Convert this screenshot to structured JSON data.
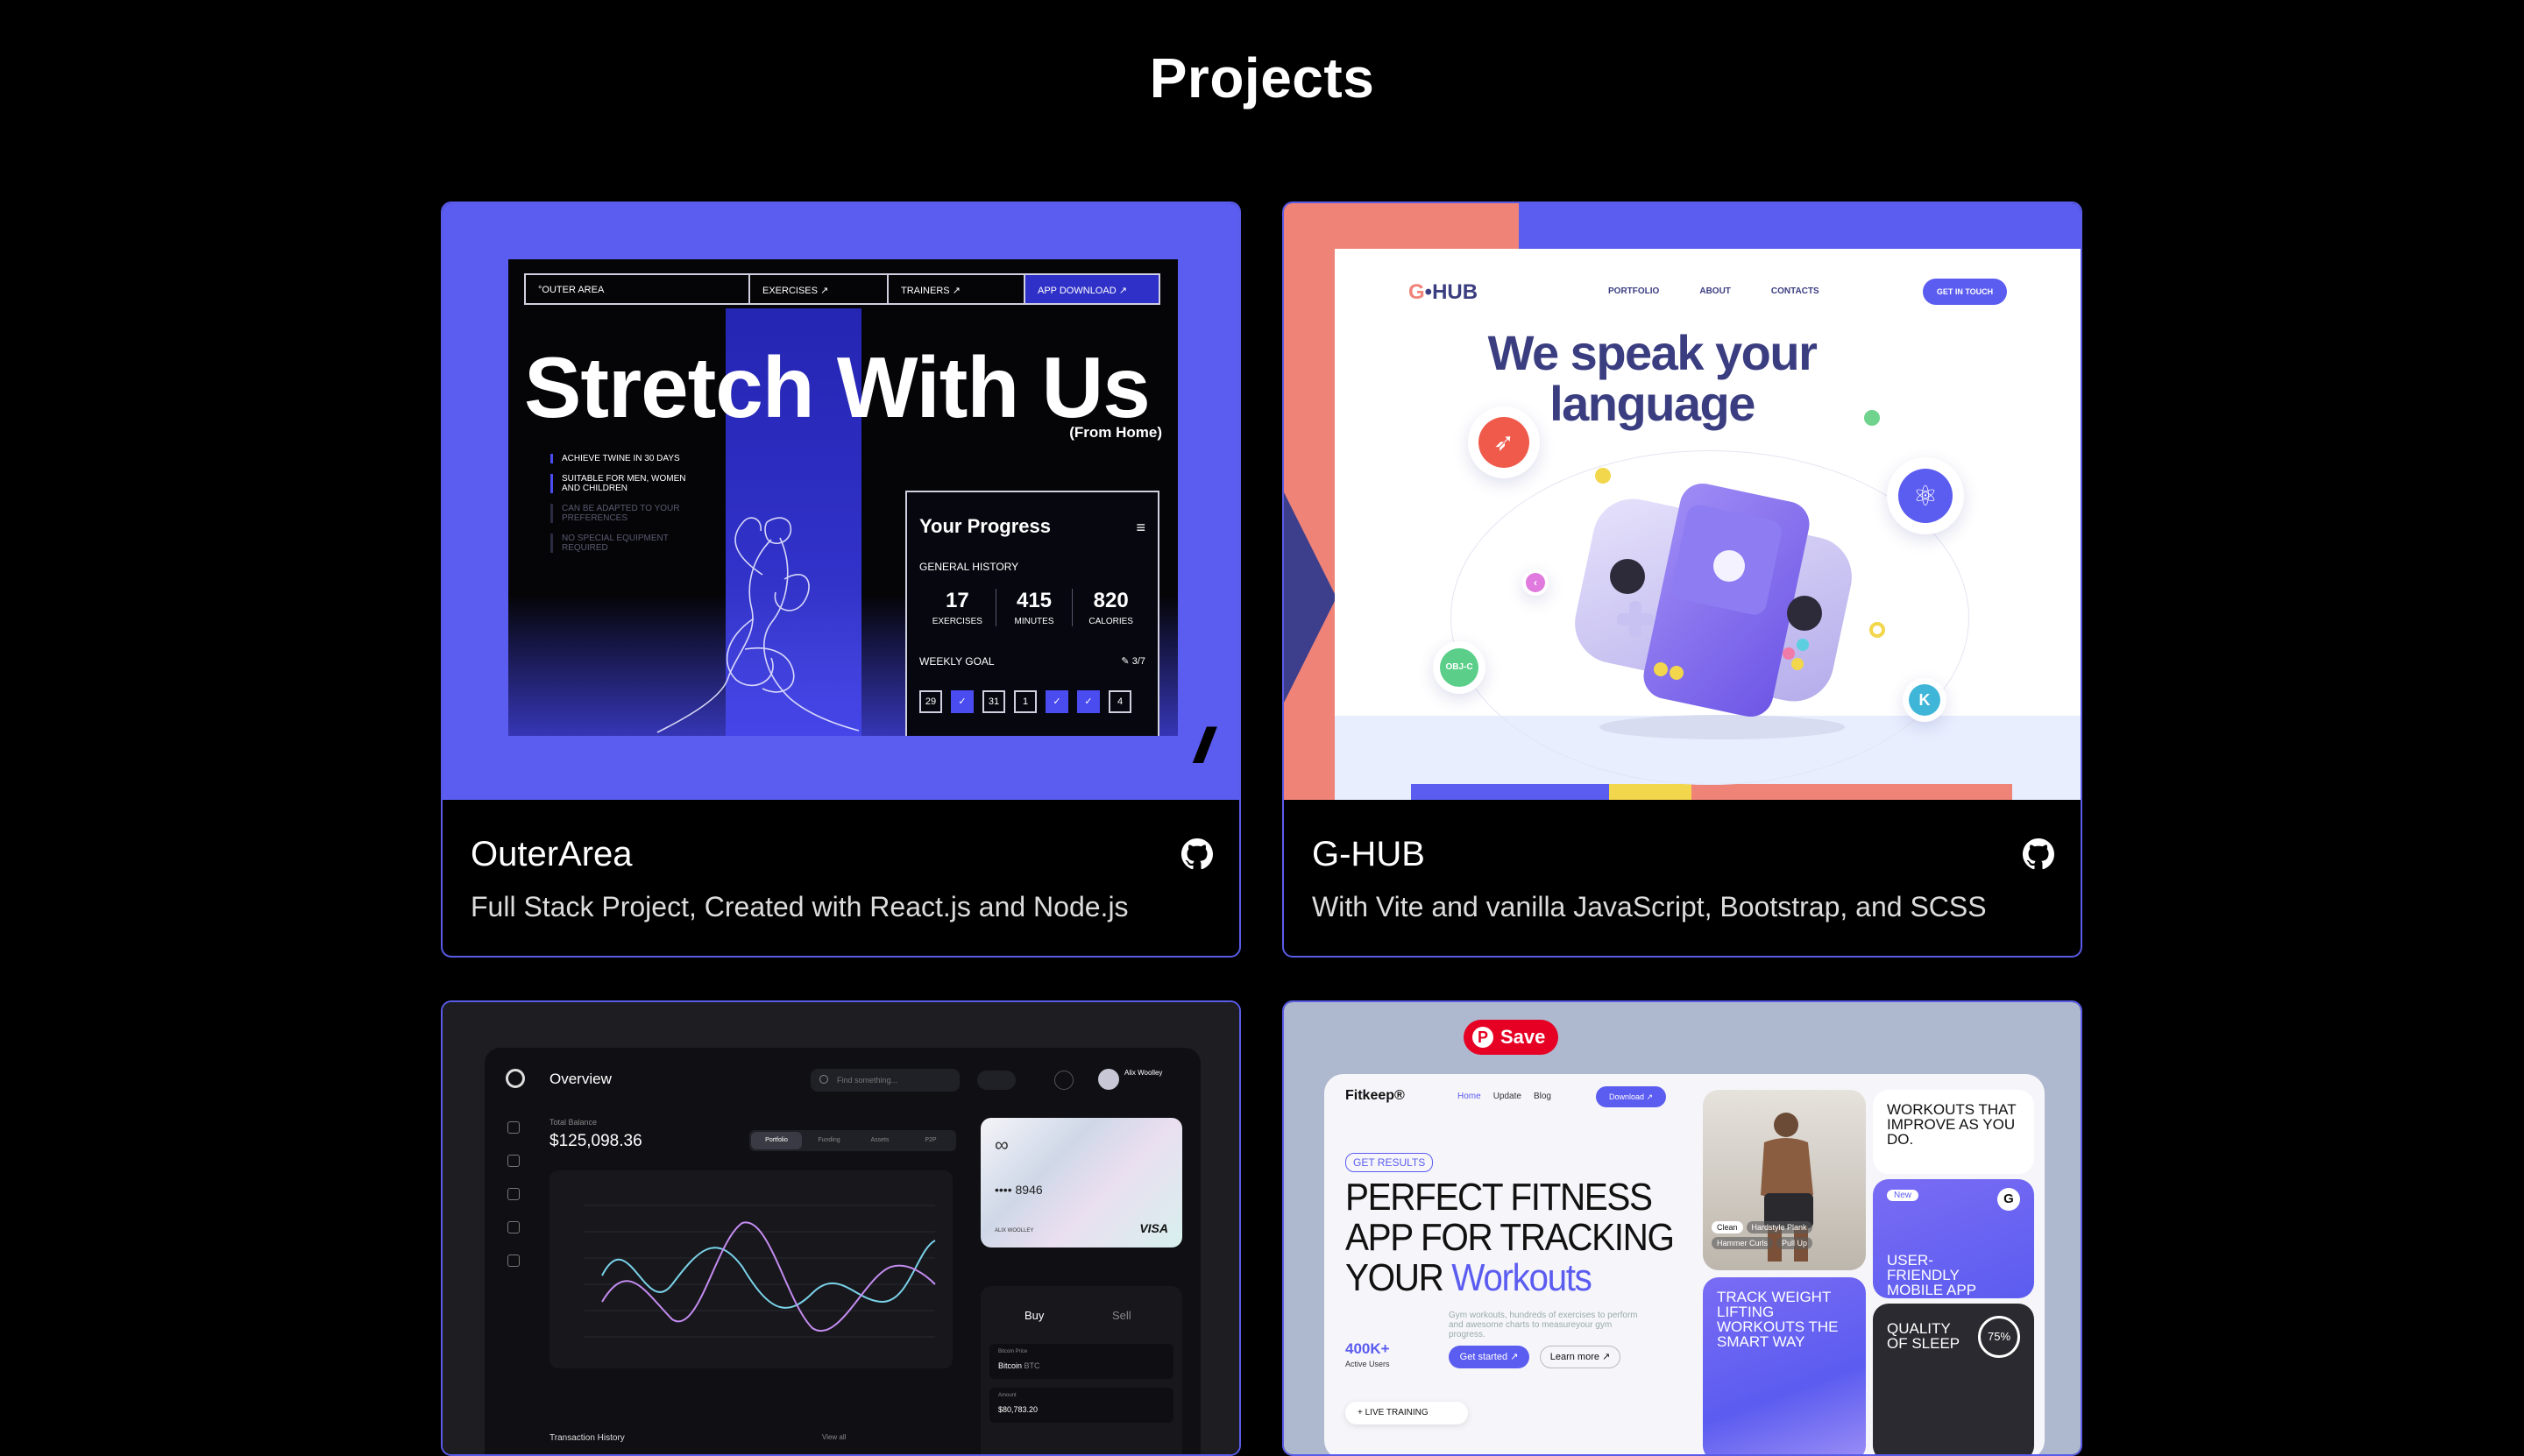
{
  "page": {
    "title": "Projects"
  },
  "projects": [
    {
      "title": "OuterArea",
      "description": "Full Stack Project, Created with React.js and Node.js",
      "icon": "github-icon",
      "thumb": {
        "nav": [
          "°OUTER AREA",
          "EXERCISES ↗",
          "TRAINERS ↗",
          "APP DOWNLOAD ↗"
        ],
        "hero": "Stretch With Us",
        "sub": "(From Home)",
        "features": [
          "ACHIEVE TWINE IN 30 DAYS",
          "SUITABLE FOR MEN, WOMEN AND CHILDREN",
          "CAN BE ADAPTED TO YOUR PREFERENCES",
          "NO SPECIAL EQUIPMENT REQUIRED"
        ],
        "panel_title": "Your Progress",
        "general_history": "GENERAL HISTORY",
        "stats": [
          {
            "value": "17",
            "label": "EXERCISES"
          },
          {
            "value": "415",
            "label": "MINUTES"
          },
          {
            "value": "820",
            "label": "CALORIES"
          }
        ],
        "weekly_goal": "WEEKLY GOAL",
        "weekly_value": "✎ 3/7",
        "days": [
          "29",
          "✓",
          "31",
          "1",
          "✓",
          "✓",
          "4"
        ],
        "mark": "//"
      }
    },
    {
      "title": "G-HUB",
      "description": "With Vite and vanilla JavaScript, Bootstrap, and SCSS",
      "icon": "github-icon",
      "thumb": {
        "logo_a": "G",
        "logo_b": "•HUB",
        "nav": [
          "PORTFOLIO",
          "ABOUT",
          "CONTACTS"
        ],
        "cta": "GET IN TOUCH",
        "headline_1": "We speak your",
        "headline_2": "language",
        "badge_objc": "OBJ-C",
        "colors": {
          "coral": "#f08378",
          "indigo": "#5b5cf0",
          "navy": "#3a3d80",
          "yellow": "#f2d64b"
        }
      }
    },
    {
      "thumb": {
        "title": "Overview",
        "search": "Find something...",
        "user": "Alix Woolley",
        "total_balance_label": "Total Balance",
        "total_balance": "$125,098.36",
        "tabs": [
          "Portfolio",
          "Funding",
          "Assets",
          "P2P"
        ],
        "card_number": "•••• 8946",
        "card_holder": "ALIX WOOLLEY",
        "card_brand": "VISA",
        "buy": "Buy",
        "sell": "Sell",
        "bitcoin_price_label": "Bitcoin Price",
        "bitcoin": "Bitcoin",
        "btc": "BTC",
        "amount_label": "Amount",
        "amount": "$80,783.20",
        "transaction_history": "Transaction History",
        "view_all": "View all"
      }
    },
    {
      "thumb": {
        "save": "Save",
        "brand": "Fitkeep®",
        "links": [
          "Home",
          "Update",
          "Blog"
        ],
        "download": "Download ↗",
        "badge": "GET RESULTS",
        "headline_1": "PERFECT FITNESS",
        "headline_2": "APP FOR TRACKING",
        "headline_3": "YOUR ",
        "headline_accent": "Workouts",
        "users": "400K+",
        "users_label": "Active Users",
        "blurb": "Gym workouts, hundreds of exercises to perform and awesome charts to measureyour gym progress.",
        "get_started": "Get started ↗",
        "learn_more": "Learn more ↗",
        "live_training": "+ LIVE TRAINING",
        "tile_improve": "WORKOUTS THAT IMPROVE AS YOU DO.",
        "tile_friendly": "USER-FRIENDLY MOBILE APP",
        "tile_new": "New",
        "tile_track": "TRACK WEIGHT LIFTING WORKOUTS THE SMART WAY",
        "tile_sleep": "QUALITY OF SLEEP",
        "sleep_pct": "75%",
        "photo_tags": [
          "Clean",
          "Hardstyle Plank",
          "Hammer Curls",
          "Pull Up"
        ]
      }
    }
  ]
}
